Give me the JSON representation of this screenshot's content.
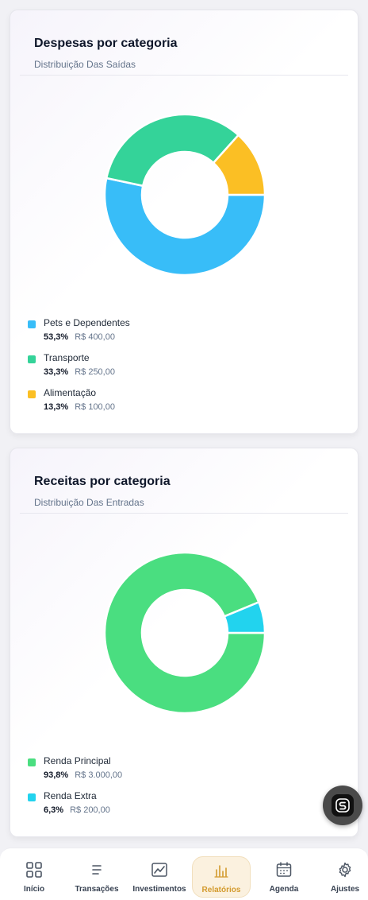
{
  "expenses_card": {
    "title": "Despesas por categoria",
    "subtitle": "Distribuição Das Saídas",
    "items": [
      {
        "name": "Pets e Dependentes",
        "pct": "53,3%",
        "amount": "R$ 400,00",
        "color": "#38bdf8"
      },
      {
        "name": "Transporte",
        "pct": "33,3%",
        "amount": "R$ 250,00",
        "color": "#34d399"
      },
      {
        "name": "Alimentação",
        "pct": "13,3%",
        "amount": "R$ 100,00",
        "color": "#fbbf24"
      }
    ]
  },
  "income_card": {
    "title": "Receitas por categoria",
    "subtitle": "Distribuição Das Entradas",
    "items": [
      {
        "name": "Renda Principal",
        "pct": "93,8%",
        "amount": "R$ 3.000,00",
        "color": "#4ade80"
      },
      {
        "name": "Renda Extra",
        "pct": "6,3%",
        "amount": "R$ 200,00",
        "color": "#22d3ee"
      }
    ]
  },
  "chart_data": [
    {
      "type": "pie",
      "title": "Despesas por categoria",
      "subtitle": "Distribuição Das Saídas",
      "categories": [
        "Pets e Dependentes",
        "Transporte",
        "Alimentação"
      ],
      "values": [
        400,
        250,
        100
      ],
      "percentages": [
        53.3,
        33.3,
        13.3
      ],
      "colors": [
        "#38bdf8",
        "#34d399",
        "#fbbf24"
      ],
      "donut": true,
      "legend": "bottom"
    },
    {
      "type": "pie",
      "title": "Receitas por categoria",
      "subtitle": "Distribuição Das Entradas",
      "categories": [
        "Renda Principal",
        "Renda Extra"
      ],
      "values": [
        3000,
        200
      ],
      "percentages": [
        93.8,
        6.3
      ],
      "colors": [
        "#4ade80",
        "#22d3ee"
      ],
      "donut": true,
      "legend": "bottom"
    }
  ],
  "fab": {
    "icon": "brand-logo-icon"
  },
  "nav": {
    "active": "reports",
    "items": [
      {
        "key": "home",
        "label": "Início",
        "icon": "grid-icon"
      },
      {
        "key": "transactions",
        "label": "Transações",
        "icon": "list-icon"
      },
      {
        "key": "investments",
        "label": "Investimentos",
        "icon": "trend-chart-icon"
      },
      {
        "key": "reports",
        "label": "Relatórios",
        "icon": "bar-chart-icon"
      },
      {
        "key": "agenda",
        "label": "Agenda",
        "icon": "calendar-icon"
      },
      {
        "key": "settings",
        "label": "Ajustes",
        "icon": "gear-icon"
      }
    ],
    "accent_color": "#d39a2d"
  }
}
